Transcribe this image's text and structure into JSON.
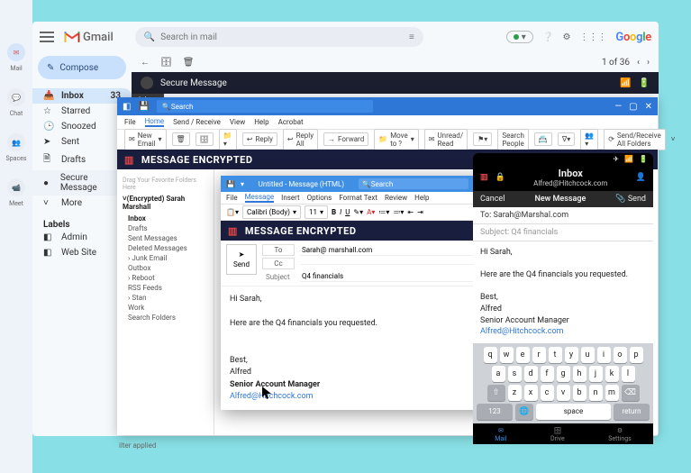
{
  "googleApps": {
    "items": [
      {
        "label": "Mail",
        "badge": ""
      },
      {
        "label": "Chat"
      },
      {
        "label": "Spaces"
      },
      {
        "label": "Meet"
      }
    ]
  },
  "gmail": {
    "brand": "Gmail",
    "searchPlaceholder": "Search in mail",
    "googleWord": "Google",
    "compose": "Compose",
    "inboxCount": "33",
    "sidebar": [
      {
        "icon": "📥",
        "label": "Inbox",
        "active": true
      },
      {
        "icon": "☆",
        "label": "Starred"
      },
      {
        "icon": "🕒",
        "label": "Snoozed"
      },
      {
        "icon": "➤",
        "label": "Sent"
      },
      {
        "icon": "🗎",
        "label": "Drafts"
      },
      {
        "icon": "●",
        "label": "Secure Message"
      },
      {
        "icon": "˅",
        "label": "More"
      }
    ],
    "labelsHeading": "Labels",
    "labels": [
      {
        "label": "Admin"
      },
      {
        "label": "Web Site"
      }
    ],
    "toolbarPage": "1 of 36",
    "secureTabText": "Secure Message",
    "inboxTab": "Inbox"
  },
  "outlook": {
    "searchPlaceholder": "Search",
    "menus": [
      "File",
      "Home",
      "Send / Receive",
      "View",
      "Help",
      "Acrobat"
    ],
    "selectedMenu": "Home",
    "ribbon": {
      "newEmail": "New Email",
      "reply": "Reply",
      "replyAll": "Reply All",
      "forward": "Forward",
      "moveTo": "Move to ?",
      "unreadRead": "Unread/ Read",
      "searchPeople": "Search People",
      "sendReceive": "Send/Receive All Folders"
    },
    "encryptedBanner": "MESSAGE ENCRYPTED",
    "sidebar": {
      "hint": "Drag Your Favorite Folders Here",
      "account": "(Encrypted) Sarah Marshall",
      "folders": [
        "Inbox",
        "Drafts",
        "Sent Messages",
        "Deleted Messages",
        "Junk Email",
        "Outbox",
        "Reboot",
        "RSS Feeds",
        "Stan",
        "Work",
        "Search Folders"
      ]
    },
    "footer": "ilter applied"
  },
  "outlookCompose": {
    "title": "Untitled - Message (HTML)",
    "searchPlaceholder": "Search",
    "menus": [
      "File",
      "Message",
      "Insert",
      "Options",
      "Format Text",
      "Review",
      "Help"
    ],
    "selectedMenu": "Message",
    "font": "Calibri (Body)",
    "fontSize": "11",
    "encryptedBanner": "MESSAGE ENCRYPTED",
    "sendLabel": "Send",
    "toLabel": "To",
    "ccLabel": "Cc",
    "subjectLabel": "Subject",
    "to": "Sarah@ marshall.com",
    "cc": "",
    "subject": "Q4 financials",
    "body": {
      "greeting": "Hi Sarah,",
      "line1": "Here are the Q4 financials you requested.",
      "closing": "Best,",
      "name": "Alfred",
      "titleLine": "Senior Account Manager",
      "email": "Alfred@Hitchcock.com"
    }
  },
  "mobile": {
    "inboxTitle": "Inbox",
    "fromEmail": "Alfred@Hitchcock.com",
    "cancel": "Cancel",
    "newMessage": "New Message",
    "send": "Send",
    "toPrefix": "To:",
    "toValue": "Sarah@Marshal.com",
    "subjectPrefix": "Subject:",
    "subjectValue": "Q4 financials",
    "body": {
      "greeting": "Hi Sarah,",
      "line1": "Here are the Q4 financials you requested.",
      "closing": "Best,",
      "name": "Alfred",
      "titleLine": "Senior Account Manager",
      "email": "Alfred@Hitchcock.com"
    },
    "keyboard": {
      "row1": [
        "q",
        "w",
        "e",
        "r",
        "t",
        "y",
        "u",
        "i",
        "o",
        "p"
      ],
      "row2": [
        "a",
        "s",
        "d",
        "f",
        "g",
        "h",
        "j",
        "k",
        "l"
      ],
      "row3": [
        "z",
        "x",
        "c",
        "v",
        "b",
        "n",
        "m"
      ],
      "shift": "⇧",
      "back": "⌫",
      "numKey": "123",
      "globe": "🌐",
      "space": "space",
      "ret": "return"
    },
    "nav": [
      {
        "label": "Mail",
        "active": true
      },
      {
        "label": "Drive"
      },
      {
        "label": "Settings"
      }
    ]
  }
}
